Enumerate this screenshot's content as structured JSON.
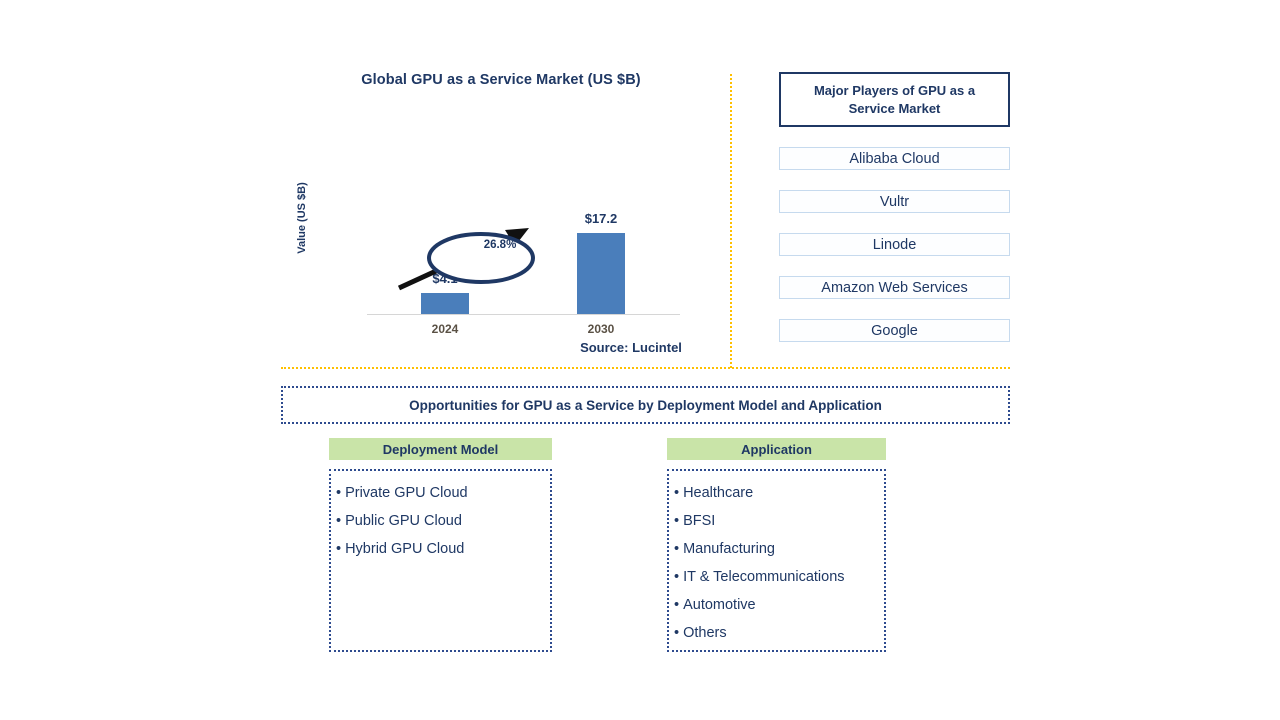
{
  "chart_panel": {
    "title": "Global GPU as a Service Market (US $B)",
    "source": "Source: Lucintel",
    "cagr_label": "26.8%"
  },
  "chart_data": {
    "type": "bar",
    "title": "Global GPU as a Service Market (US $B)",
    "xlabel": "",
    "ylabel": "Value (US $B)",
    "categories": [
      "2024",
      "2030"
    ],
    "values": [
      4.1,
      17.2
    ],
    "value_labels": [
      "$4.1",
      "$17.2"
    ],
    "ylim": [
      0,
      19
    ],
    "grid": false,
    "legend": "none",
    "annotations": [
      {
        "text": "26.8%",
        "type": "cagr-callout",
        "from": "2024",
        "to": "2030"
      }
    ],
    "series_color": "#4a7ebb"
  },
  "players": {
    "header": "Major Players of GPU as a Service Market",
    "items": [
      "Alibaba Cloud",
      "Vultr",
      "Linode",
      "Amazon Web Services",
      "Google"
    ]
  },
  "opportunities": {
    "title": "Opportunities for GPU as a Service by Deployment Model and Application",
    "columns": [
      {
        "header": "Deployment Model",
        "items": [
          "Private GPU Cloud",
          "Public GPU Cloud",
          "Hybrid GPU Cloud"
        ]
      },
      {
        "header": "Application",
        "items": [
          "Healthcare",
          "BFSI",
          "Manufacturing",
          "IT & Telecommunications",
          "Automotive",
          "Others"
        ]
      }
    ]
  },
  "colors": {
    "bar": "#4a7ebb",
    "navy": "#1f3864",
    "divider": "#ffc000",
    "header_green": "#c9e4a8"
  }
}
